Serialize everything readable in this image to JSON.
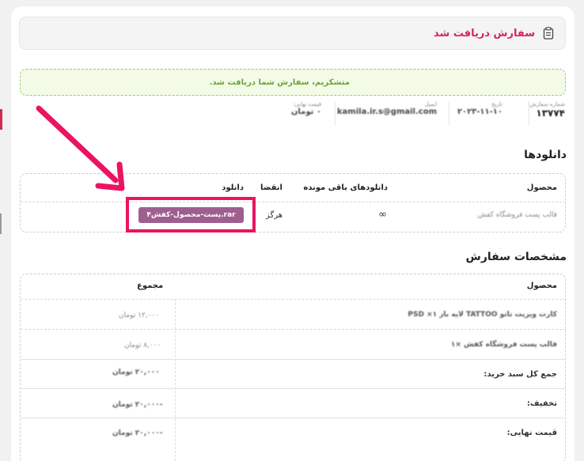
{
  "header": {
    "title": "سفارش دریافت شد",
    "icon": "clipboard-icon"
  },
  "notice": {
    "text": "متشکریم، سفارش شما دریافت شد."
  },
  "meta": [
    {
      "label": "شماره سفارش:",
      "value": "۱۳۷۷۴"
    },
    {
      "label": "تاریخ",
      "value": "۲۰۲۳-۱۱-۱۰"
    },
    {
      "label": "ایمیل",
      "value": "kamila.ir.s@gmail.com"
    },
    {
      "label": "قیمت نهایی:",
      "value": "۰ تومان"
    }
  ],
  "downloads": {
    "title": "دانلودها",
    "headers": {
      "product": "محصول",
      "remaining": "دانلودهای باقی مونده",
      "expires": "انقضا",
      "download": "دانلود"
    },
    "row": {
      "product": "قالب پست فروشگاه کفش",
      "remaining": "∞",
      "expires": "هرگز",
      "file": "۴پست-محصول-کفش.rar"
    }
  },
  "order": {
    "title": "مشخصات سفارش",
    "headers": {
      "product": "محصول",
      "total": "مجموع"
    },
    "items": [
      {
        "name": "کارت ویزیت تاتو TATTOO لایه باز PSD ×۱",
        "price": "۱۲,۰۰۰ تومان"
      },
      {
        "name": "قالب پست فروشگاه کفش ×۱",
        "price": "۸,۰۰۰ تومان"
      }
    ],
    "summary": [
      {
        "label": "جمع کل سبد خرید:",
        "value": "۲۰,۰۰۰ تومان"
      },
      {
        "label": "تخفیف:",
        "value": "-۲۰,۰۰۰ تومان"
      },
      {
        "label": "قیمت نهایی:",
        "value": "-۲۰,۰۰۰ تومان"
      }
    ]
  },
  "colors": {
    "accent": "#d6245a",
    "notice_text": "#6ca337",
    "download_button": "#9e5f8f",
    "highlight": "#ea1461"
  }
}
